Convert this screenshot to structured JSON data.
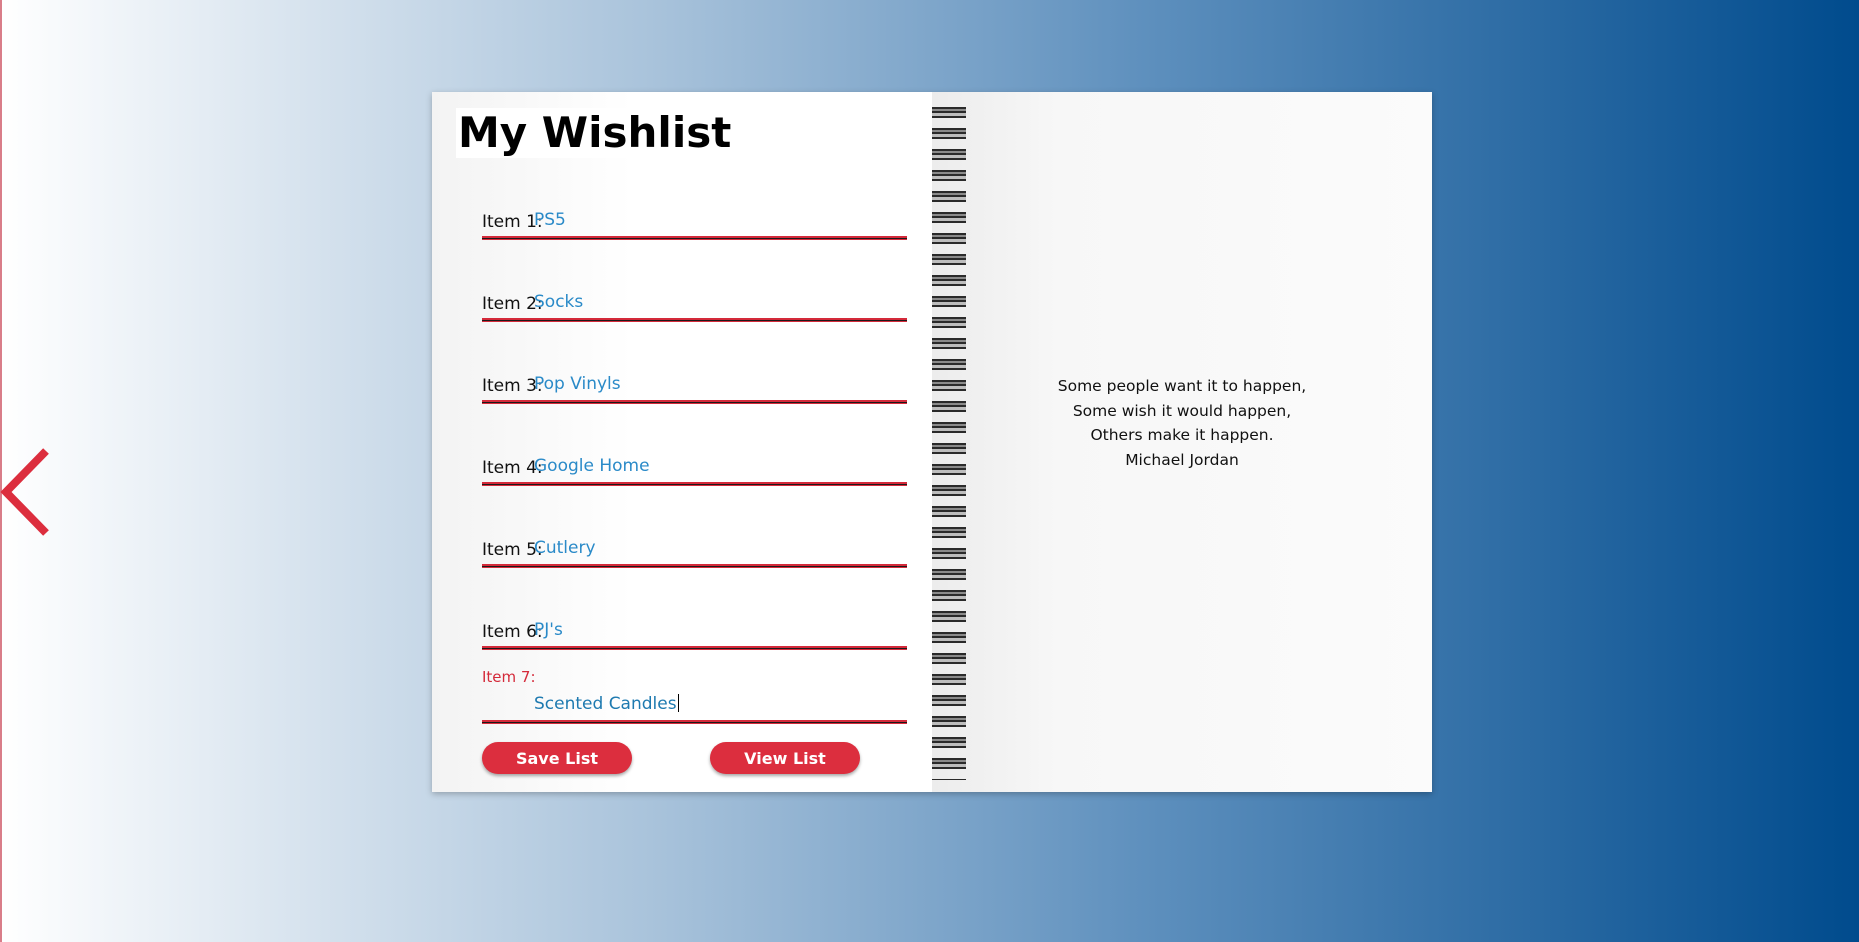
{
  "wishlist": {
    "title": "My Wishlist",
    "items": [
      {
        "label": "Item 1:",
        "value": "PS5"
      },
      {
        "label": "Item 2:",
        "value": "Socks"
      },
      {
        "label": "Item 3:",
        "value": "Pop Vinyls"
      },
      {
        "label": "Item 4:",
        "value": "Google Home"
      },
      {
        "label": "Item 5:",
        "value": "Cutlery"
      },
      {
        "label": "Item 6:",
        "value": "PJ's"
      },
      {
        "label": "Item 7:",
        "value": "Scented Candles"
      }
    ],
    "save_label": "Save List",
    "view_label": "View List"
  },
  "quote": {
    "lines": [
      "Some people want it to happen,",
      "Some wish it would happen,",
      "Others make it happen."
    ],
    "author": "Michael Jordan"
  },
  "nav": {
    "back_icon": "chevron-left-icon"
  },
  "colors": {
    "accent": "#dc2e3e",
    "input_text": "#2a8ac8",
    "background_end": "#004b8d"
  }
}
